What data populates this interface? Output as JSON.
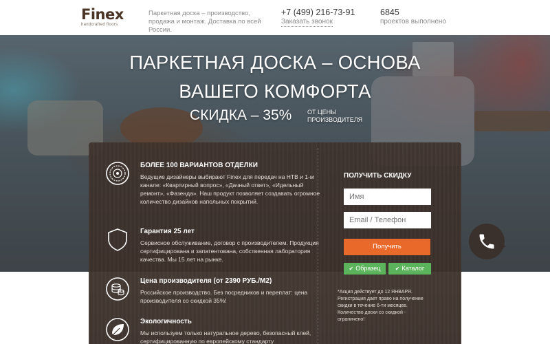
{
  "header": {
    "logo_word": "Finex",
    "logo_tagline": "handcrafted floors",
    "description": "Паркетная доска – производство, продажа и монтаж. Доставка по всей России.",
    "phone": "+7 (499) 216-73-91",
    "callback_label": "Заказать звонок",
    "projects_count": "6845",
    "projects_label": "проектов выполнено"
  },
  "hero": {
    "title_line1": "ПАРКЕТНАЯ ДОСКА – ОСНОВА",
    "title_line2": "ВАШЕГО КОМФОРТА",
    "discount": "СКИДКА – 35%",
    "discount_note": "ОТ ЦЕНЫ ПРОИЗВОДИТЕЛЯ"
  },
  "features": [
    {
      "icon": "mandala-icon",
      "title": "БОЛЕЕ 100 ВАРИАНТОВ ОТДЕЛКИ",
      "text": "Ведущие дизайнеры выбирают Finex для передач на НТВ и 1-м канале: «Квартирный вопрос», «Дачный ответ», «Идельный ремонт», «Фазенда». Наш продукт позволяет создавать огромное количество дизайнов напольных покрытий."
    },
    {
      "icon": "shield-icon",
      "title": "Гарантия 25 лет",
      "text": "Сервисное обслуживание, договор с производителем. Продукция сертифицирована и запатентована, собственная лаборатория качества. Мы 15 лет на рынке."
    },
    {
      "icon": "coins-icon",
      "title": "Цена производителя (от 2390 РУБ./М2)",
      "text": "Российское производство. Без посредников и переплат: цена производителя со скидкой 35%!"
    },
    {
      "icon": "leaf-icon",
      "title": "Экологичность",
      "text": "Мы используем только натуральное дерево, безопасный клей, сертифицированную по европейскому стандарту"
    }
  ],
  "form": {
    "title": "ПОЛУЧИТЬ СКИДКУ",
    "name_placeholder": "Имя",
    "contact_placeholder": "Email / Телефон",
    "submit_label": "Получить",
    "sample_label": "Образец",
    "catalog_label": "Каталог",
    "note": "*Акция действует до 12 ЯНВАРЯ. Регистрация дает право на получение скидки в течение 6-ти месяцев. Количество доски со скидкой - ограничено!"
  },
  "colors": {
    "accent_orange": "#e8692a",
    "accent_green": "#5bb35b",
    "panel_brown": "#3e322c",
    "logo_brown": "#4a3426"
  },
  "icons": {
    "phone": "phone-icon",
    "check": "check-icon"
  }
}
